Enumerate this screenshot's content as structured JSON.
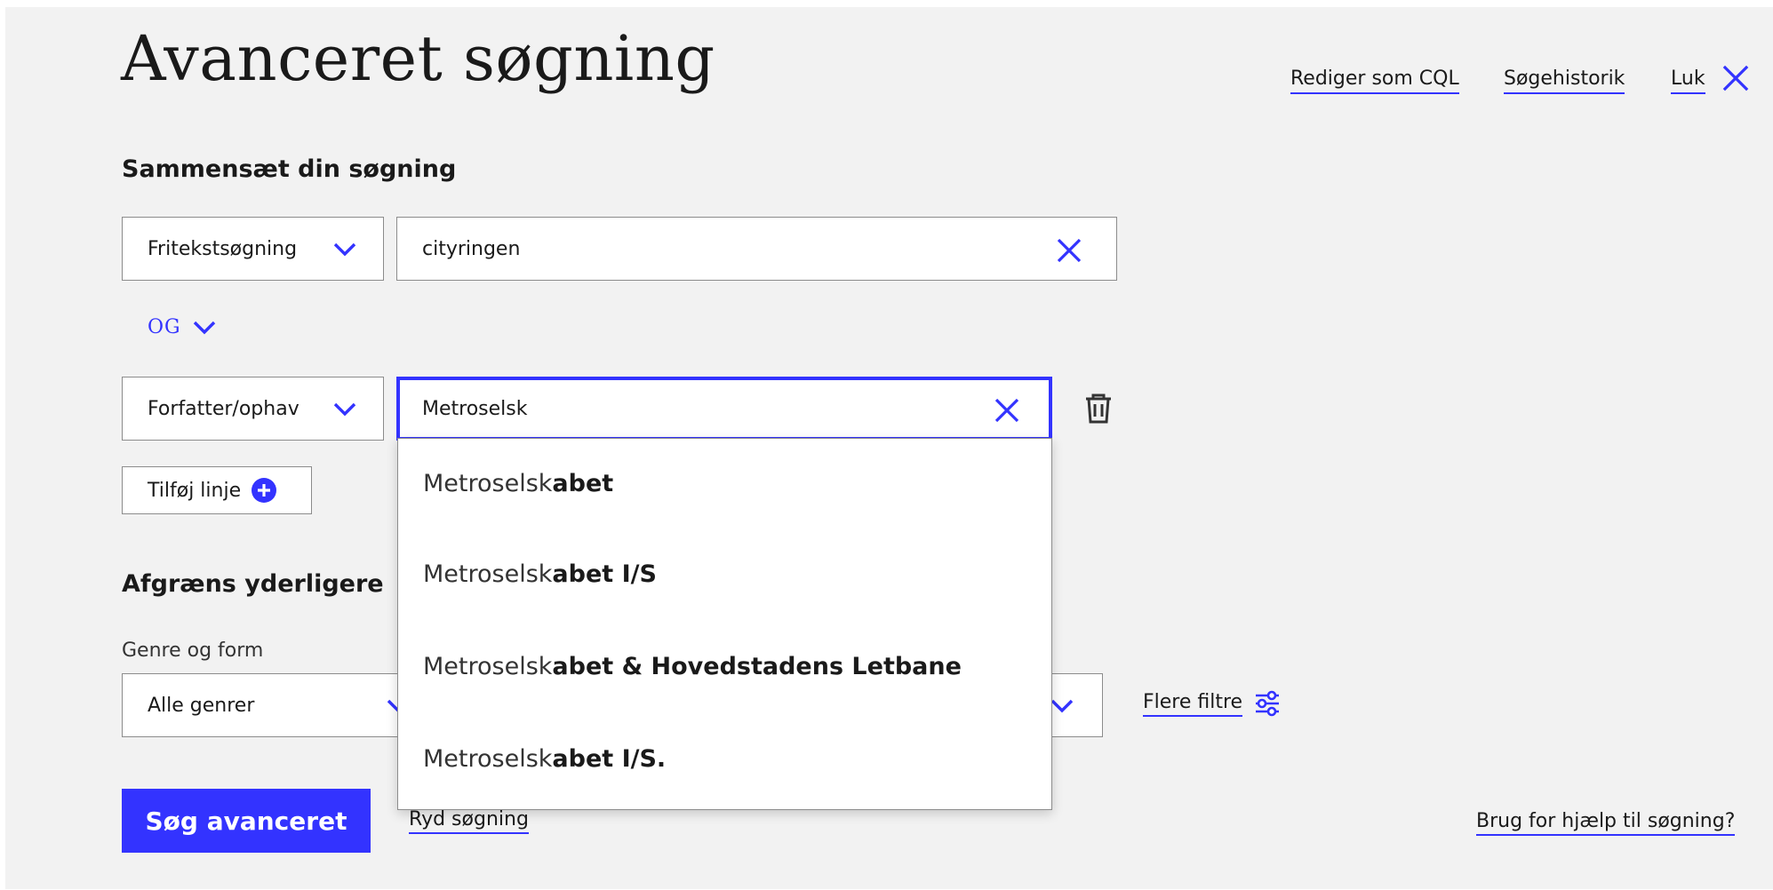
{
  "header": {
    "title": "Avanceret søgning",
    "links": {
      "edit_cql": "Rediger som CQL",
      "history": "Søgehistorik",
      "close": "Luk"
    }
  },
  "compose": {
    "heading": "Sammensæt din søgning",
    "rows": [
      {
        "field": "Fritekstsøgning",
        "value": "cityringen"
      },
      {
        "field": "Forfatter/ophav",
        "value": "Metroselsk"
      }
    ],
    "operator": "OG",
    "add_line": "Tilføj linje"
  },
  "suggestions": [
    {
      "prefix": "Metroselsk",
      "rest": "abet"
    },
    {
      "prefix": "Metroselsk",
      "rest": "abet I/S"
    },
    {
      "prefix": "Metroselsk",
      "rest": "abet & Hovedstadens Letbane"
    },
    {
      "prefix": "Metroselsk",
      "rest": "abet I/S."
    }
  ],
  "refine": {
    "heading": "Afgræns yderligere",
    "genre_label": "Genre og form",
    "genre_value": "Alle genrer",
    "more_filters": "Flere filtre"
  },
  "actions": {
    "search": "Søg avanceret",
    "clear": "Ryd søgning",
    "help": "Brug for hjælp til søgning?"
  },
  "colors": {
    "accent": "#3333ff",
    "panel_background": "#f2f2f2"
  }
}
